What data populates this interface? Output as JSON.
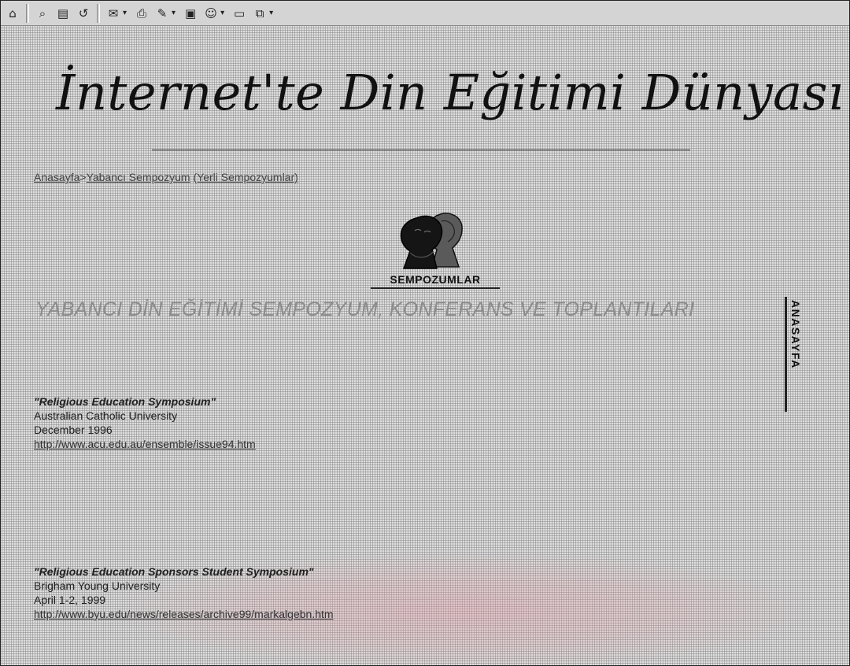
{
  "toolbar": {
    "buttons": [
      {
        "icon": "home-icon",
        "glyph": "⌂",
        "dropdown": false
      },
      {
        "icon": "search-icon",
        "glyph": "⌕",
        "dropdown": false
      },
      {
        "icon": "favorites-icon",
        "glyph": "▤",
        "dropdown": false
      },
      {
        "icon": "history-icon",
        "glyph": "↺",
        "dropdown": false
      },
      {
        "icon": "mail-icon",
        "glyph": "✉",
        "dropdown": true
      },
      {
        "icon": "print-icon",
        "glyph": "⎙",
        "dropdown": false
      },
      {
        "icon": "edit-icon",
        "glyph": "✎",
        "dropdown": true
      },
      {
        "icon": "discuss-icon",
        "glyph": "▣",
        "dropdown": false
      },
      {
        "icon": "messenger-icon",
        "glyph": "☺",
        "dropdown": true
      },
      {
        "icon": "window-icon",
        "glyph": "▭",
        "dropdown": false
      },
      {
        "icon": "related-icon",
        "glyph": "⧉",
        "dropdown": true
      }
    ]
  },
  "site": {
    "title": "İnternet'te Din Eğitimi Dünyası"
  },
  "breadcrumb": {
    "home": "Anasayfa",
    "separator": ">",
    "foreign": "Yabancı Sempozyum",
    "local": "(Yerli Sempozyumlar)"
  },
  "logo": {
    "label": "SEMPOZUMLAR"
  },
  "main": {
    "heading": "YABANCI DİN EĞİTİMİ SEMPOZYUM, KONFERANS VE TOPLANTILARI"
  },
  "sidebar": {
    "home_label": "ANASAYFA"
  },
  "entries": [
    {
      "title": "\"Religious Education Symposium\"",
      "organization": "Australian Catholic University",
      "date": "December 1996",
      "url": "http://www.acu.edu.au/ensemble/issue94.htm"
    },
    {
      "title": "\"Religious Education Sponsors Student Symposium\"",
      "organization": "Brigham Young University",
      "date": "April 1-2, 1999",
      "url": "http://www.byu.edu/news/releases/archive99/markalgebn.htm"
    }
  ]
}
